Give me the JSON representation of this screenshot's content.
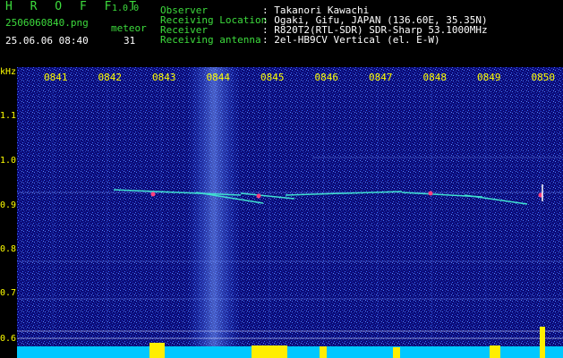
{
  "app": {
    "name": "H R O F F T",
    "version": "1.0.0",
    "filename": "2506060840.png",
    "datetime": "25.06.06 08:40",
    "count_label": "meteor",
    "count_value": "31"
  },
  "info": {
    "labels": [
      "Observer",
      "Receiving Location",
      "Receiver",
      "Receiving antenna"
    ],
    "values": [
      ": Takanori Kawachi",
      ": Ogaki, Gifu, JAPAN (136.60E, 35.35N)",
      ": R820T2(RTL-SDR) SDR-Sharp 53.1000MHz",
      ": 2el-HB9CV Vertical (el. E-W)"
    ]
  },
  "axis": {
    "y_unit": "kHz",
    "y_ticks": [
      "1.1",
      "1.0",
      "0.9",
      "0.8",
      "0.7",
      "0.6"
    ],
    "x_ticks": [
      "0841",
      "0842",
      "0843",
      "0844",
      "0845",
      "0846",
      "0847",
      "0848",
      "0849",
      "0850"
    ]
  },
  "colors": {
    "background": "#000000",
    "label_green": "#3ddc3d",
    "label_yellow": "#ffff00",
    "noise_dark": "#0a0a6e",
    "noise_light": "#3a6cff",
    "meteor_trace": "#40e0d0",
    "meteor_head": "#ff4080",
    "baseline": "#00c8ff",
    "peak": "#ffee00"
  }
}
